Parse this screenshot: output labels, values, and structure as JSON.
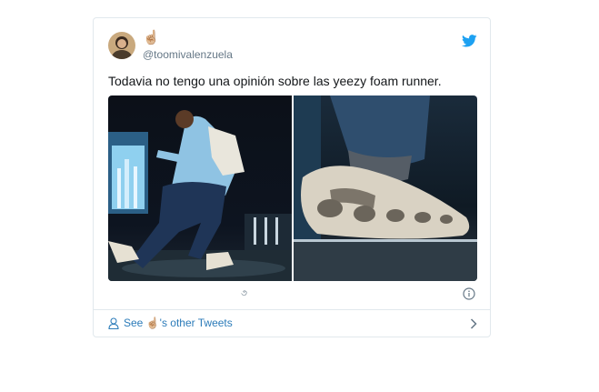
{
  "tweet": {
    "name_emoji": "☝🏼",
    "handle": "@toomivalenzuela",
    "text": "Todavia no tengo una opinión sobre las yeezy foam runner.",
    "media": [
      {
        "description_icon": "photo-concert-icon"
      },
      {
        "description_icon": "photo-shoe-icon"
      }
    ],
    "meta_glyph": "૭"
  },
  "footer": {
    "see_prefix": "See",
    "see_emoji": "☝🏼",
    "see_suffix": "'s other Tweets"
  },
  "colors": {
    "twitter_blue": "#1da1f2",
    "link_blue": "#2b7bb9",
    "muted": "#657786",
    "border": "#e1e8ed"
  },
  "icons": {
    "logo": "twitter-bird-icon",
    "info": "info-icon",
    "user": "person-icon",
    "chevron": "chevron-right-icon"
  }
}
